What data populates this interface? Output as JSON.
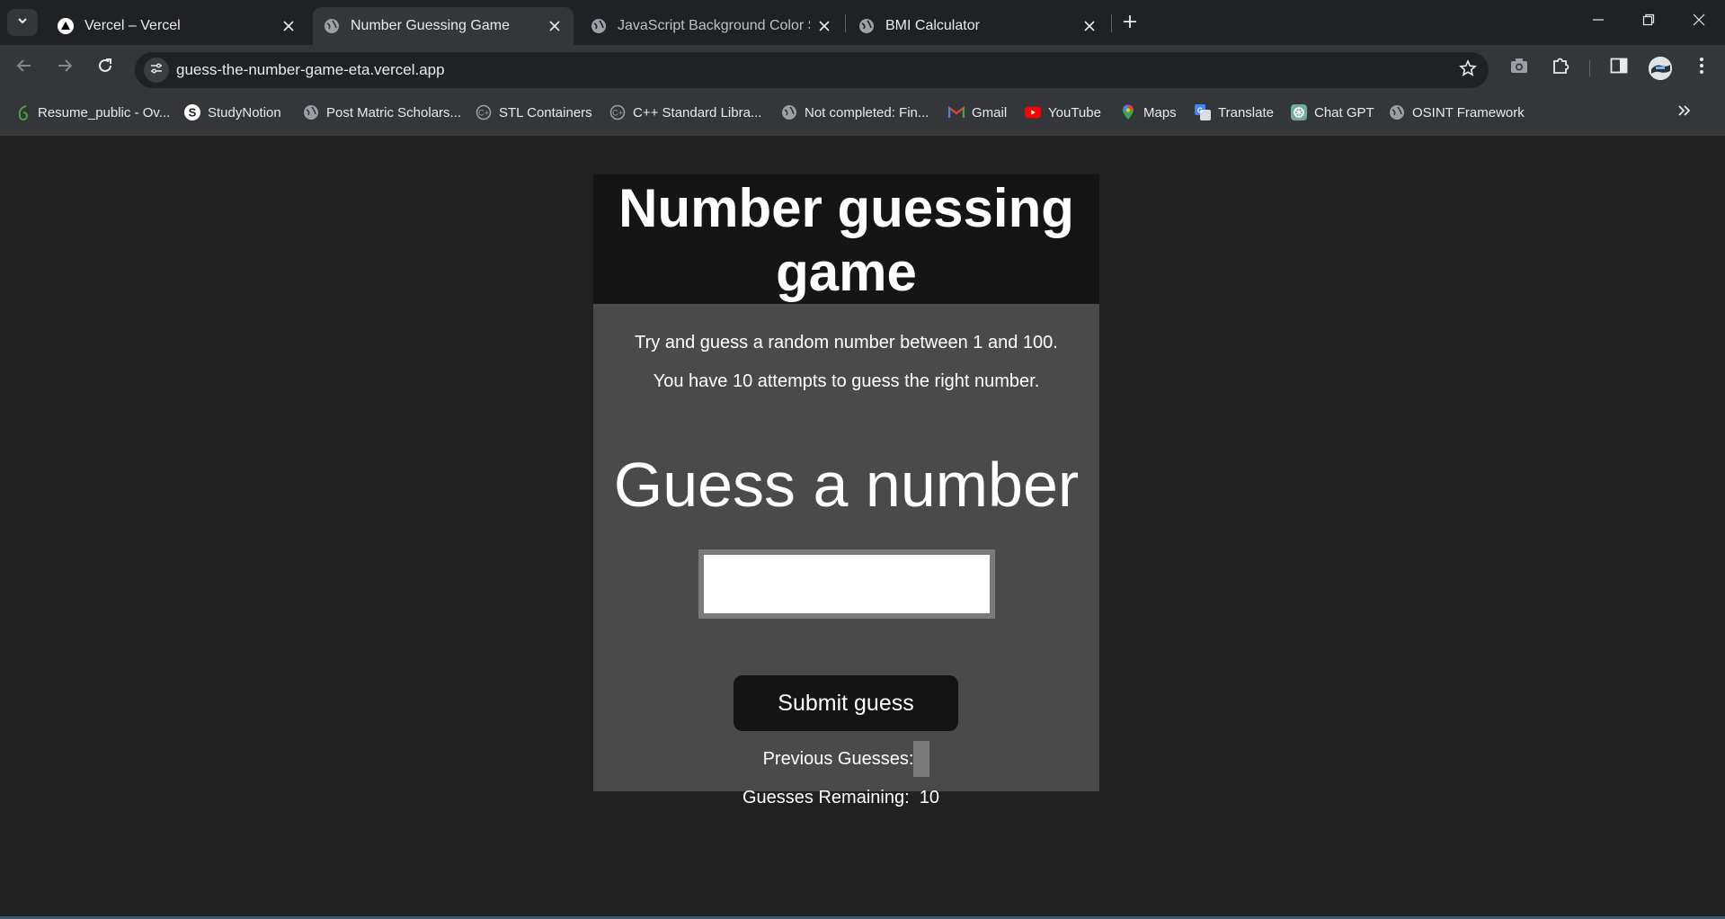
{
  "browser": {
    "tabs": [
      {
        "title": "Vercel – Vercel",
        "icon": "vercel-triangle-icon",
        "active": false
      },
      {
        "title": "Number Guessing Game",
        "icon": "globe-icon",
        "active": true
      },
      {
        "title": "JavaScript Background Color Sw",
        "icon": "globe-icon",
        "active": false
      },
      {
        "title": "BMI Calculator",
        "icon": "globe-icon",
        "active": false
      }
    ],
    "url": "guess-the-number-game-eta.vercel.app",
    "bookmarks": [
      {
        "label": "Resume_public - Ov...",
        "icon": "overleaf-icon",
        "color": "#47a141"
      },
      {
        "label": "StudyNotion",
        "icon": "studynotion-icon",
        "color": "#ffffff"
      },
      {
        "label": "Post Matric Scholars...",
        "icon": "globe-icon",
        "color": "#9aa0a6"
      },
      {
        "label": "STL Containers",
        "icon": "cplusplus-icon",
        "color": "#9aa0a6"
      },
      {
        "label": "C++ Standard Libra...",
        "icon": "cplusplus-icon",
        "color": "#9aa0a6"
      },
      {
        "label": "Not completed: Fin...",
        "icon": "globe-icon",
        "color": "#9aa0a6"
      },
      {
        "label": "Gmail",
        "icon": "gmail-icon",
        "color": "#ea4335"
      },
      {
        "label": "YouTube",
        "icon": "youtube-icon",
        "color": "#ff0000"
      },
      {
        "label": "Maps",
        "icon": "maps-pin-icon",
        "color": "#34a853"
      },
      {
        "label": "Translate",
        "icon": "translate-icon",
        "color": "#4285f4"
      },
      {
        "label": "Chat GPT",
        "icon": "chatgpt-icon",
        "color": "#74aa9c"
      },
      {
        "label": "OSINT Framework",
        "icon": "globe-icon",
        "color": "#9aa0a6"
      }
    ]
  },
  "game": {
    "title": "Number guessing game",
    "instructions": [
      "Try and guess a random number between 1 and 100.",
      "You have 10 attempts to guess the right number."
    ],
    "guess_heading": "Guess a number",
    "guess_input_value": "",
    "submit_label": "Submit guess",
    "previous_guesses_label": "Previous Guesses:",
    "previous_guesses_value": "",
    "remaining_label": "Guesses Remaining:",
    "remaining_value": "10"
  },
  "colors": {
    "page_bg": "#212121",
    "card_bg": "#4a4a4a",
    "header_bg": "#151515",
    "button_bg": "#141414"
  }
}
